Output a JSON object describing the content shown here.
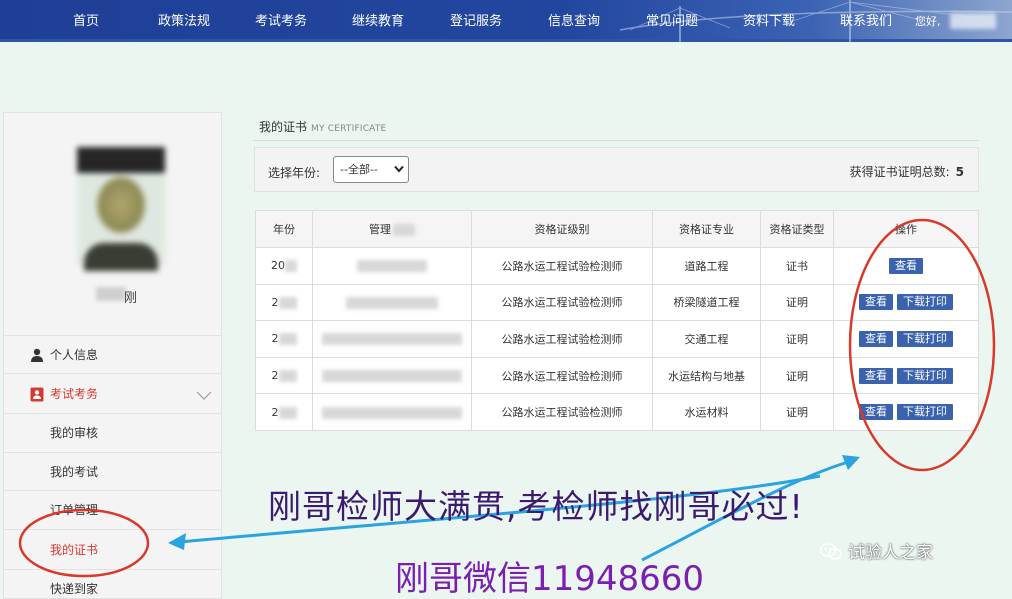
{
  "nav": {
    "items": [
      "首页",
      "政策法规",
      "考试考务",
      "继续教育",
      "登记服务",
      "信息查询",
      "常见问题",
      "资料下载",
      "联系我们"
    ],
    "greeting": "您好,"
  },
  "sidebar": {
    "username": "刚",
    "personal_info": "个人信息",
    "exam_affairs": "考试考务",
    "sub_items": [
      "我的审核",
      "我的考试",
      "订单管理",
      "我的证书",
      "快递到家"
    ]
  },
  "content": {
    "title": "我的证书",
    "title_en": "MY CERTIFICATE",
    "filter_label": "选择年份:",
    "year_select": "--全部--",
    "total_label": "获得证书证明总数:",
    "total_count": "5"
  },
  "table": {
    "headers": [
      "年份",
      "管理",
      "资格证级别",
      "资格证专业",
      "资格证类型",
      "操作"
    ],
    "rows": [
      {
        "year": "20",
        "num": "",
        "level": "公路水运工程试验检测师",
        "major": "道路工程",
        "type": "证书",
        "actions": [
          "查看"
        ]
      },
      {
        "year": "2",
        "num": "",
        "level": "公路水运工程试验检测师",
        "major": "桥梁隧道工程",
        "type": "证明",
        "actions": [
          "查看",
          "下载打印"
        ]
      },
      {
        "year": "2",
        "num": "",
        "level": "公路水运工程试验检测师",
        "major": "交通工程",
        "type": "证明",
        "actions": [
          "查看",
          "下载打印"
        ]
      },
      {
        "year": "2",
        "num": "",
        "level": "公路水运工程试验检测师",
        "major": "水运结构与地基",
        "type": "证明",
        "actions": [
          "查看",
          "下载打印"
        ]
      },
      {
        "year": "2",
        "num": "",
        "level": "公路水运工程试验检测师",
        "major": "水运材料",
        "type": "证明",
        "actions": [
          "查看",
          "下载打印"
        ]
      }
    ]
  },
  "overlay": {
    "slogan": "刚哥检师大满贯,考检师找刚哥必过!",
    "wechat": "刚哥微信11948660",
    "watermark": "试验人之家"
  },
  "colors": {
    "nav_bg": "#22469f",
    "button": "#3a62ad",
    "accent_red": "#d23b30",
    "annotation_red": "#d9392b",
    "arrow_blue": "#2ba3e0"
  }
}
